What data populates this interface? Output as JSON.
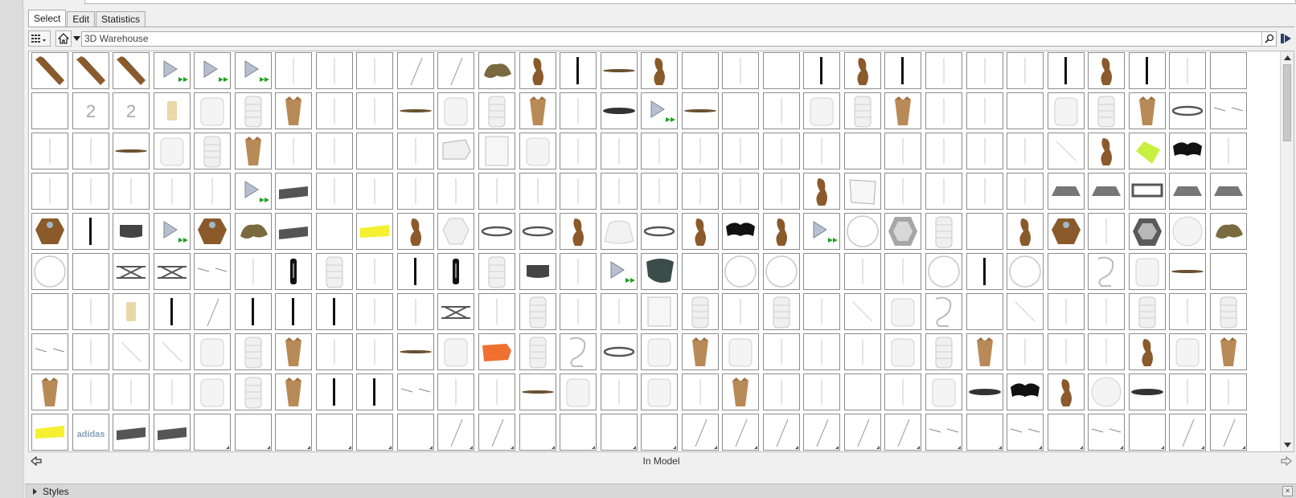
{
  "tabs": [
    {
      "label": "Select",
      "active": true
    },
    {
      "label": "Edit",
      "active": false
    },
    {
      "label": "Statistics",
      "active": false
    }
  ],
  "toolbar": {
    "view_icon": "grid-view-icon",
    "home_icon": "home-icon",
    "search_value": "3D Warehouse",
    "search_icon": "magnifier-icon",
    "go_icon": "forward-arrow-icon"
  },
  "grid": {
    "columns": 30,
    "rows": [
      "bbbppp|||//rdkld.|.kdk|||kdk|.",
      ".22tcsv||lcsv|epl.|csv||.csvR>Ov",
      "||lcsv||.|fac|||||||.|||| dgK|||.",
      "|||||pw||||||||||||dW||||TTFTTRHd",
      "Lk0pLrw.ydhRRdHRdKdpOPs.dL|Mor0r",
      "O.xx>|Ns|kNs0|pC.OO.||OkO.ucl.xs.",
      ".|tk/kkk||x|s||as|s| cu. ||s|s/vvk",
      ">|  csv||lcmsuRcvc|||csv|||dcv|cc",
      "v|||csvkk>||lc|c|v||.|ceKdoe||g|",
      "yAww......//....//////><><><////"
    ],
    "row_labels": [
      "adidas"
    ]
  },
  "status": {
    "title": "In Model",
    "prev_icon": "back-arrow-icon",
    "next_icon": "forward-arrow-icon"
  },
  "styles_panel": {
    "label": "Styles",
    "close_icon": "close-icon"
  },
  "colors": {
    "wood": "#8a5a2b",
    "wood_dark": "#5e3a18",
    "pink": "#e06ad8",
    "lime": "#c8f040",
    "yellow": "#f5f032",
    "cyan": "#30d8d8",
    "orange": "#f07030",
    "teal_dark": "#3c4c48"
  }
}
